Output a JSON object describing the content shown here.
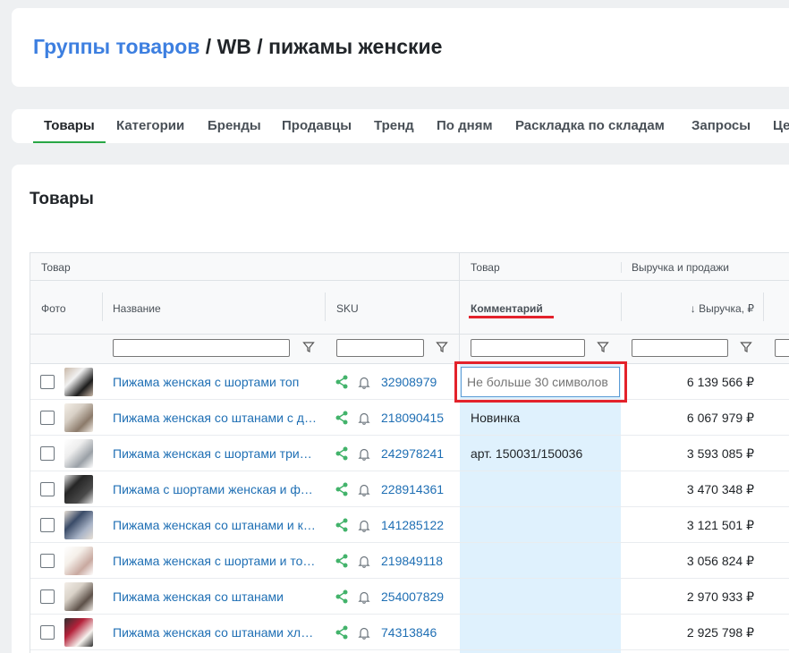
{
  "breadcrumb": {
    "link": "Группы товаров",
    "rest": " / WB / пижамы женские"
  },
  "tabs": [
    {
      "label": "Товары",
      "active": true
    },
    {
      "label": "Категории"
    },
    {
      "label": "Бренды"
    },
    {
      "label": "Продавцы"
    },
    {
      "label": "Тренд"
    },
    {
      "label": "По дням"
    },
    {
      "label": "Раскладка по складам"
    },
    {
      "label": "Запросы"
    },
    {
      "label": "Це"
    }
  ],
  "section_title": "Товары",
  "table": {
    "group_headers": {
      "product": "Товар",
      "product2": "Товар",
      "revenue": "Выручка и продажи"
    },
    "columns": {
      "photo": "Фото",
      "name": "Название",
      "sku": "SKU",
      "comment": "Комментарий",
      "revenue": "↓ Выручка, ₽"
    },
    "comment_placeholder": "Не больше 30 символов",
    "rows": [
      {
        "name": "Пижама женская с шортами топ",
        "sku": "32908979",
        "comment": "",
        "revenue": "6 139 566 ₽",
        "editing": true
      },
      {
        "name": "Пижама женская со штанами с длинным рукавом",
        "sku": "218090415",
        "comment": "Новинка",
        "revenue": "6 067 979 ₽"
      },
      {
        "name": "Пижама женская с шортами трикотажная",
        "sku": "242978241",
        "comment": "арт. 150031/150036",
        "revenue": "3 593 085 ₽"
      },
      {
        "name": "Пижама с шортами женская и футболка",
        "sku": "228914361",
        "comment": "",
        "revenue": "3 470 348 ₽"
      },
      {
        "name": "Пижама женская со штанами и кофтой",
        "sku": "141285122",
        "comment": "",
        "revenue": "3 121 501 ₽"
      },
      {
        "name": "Пижама женская с шортами и топом",
        "sku": "219849118",
        "comment": "",
        "revenue": "3 056 824 ₽"
      },
      {
        "name": "Пижама женская со штанами",
        "sku": "254007829",
        "comment": "",
        "revenue": "2 970 933 ₽"
      },
      {
        "name": "Пижама женская со штанами хлопковая",
        "sku": "74313846",
        "comment": "",
        "revenue": "2 925 798 ₽"
      }
    ]
  },
  "colors": {
    "link": "#1f6fb4",
    "accent_green": "#28a745",
    "highlight_red": "#e3222b",
    "comment_bg": "#dff1fd"
  },
  "icons": [
    "share-icon",
    "bell-icon",
    "filter-icon"
  ]
}
